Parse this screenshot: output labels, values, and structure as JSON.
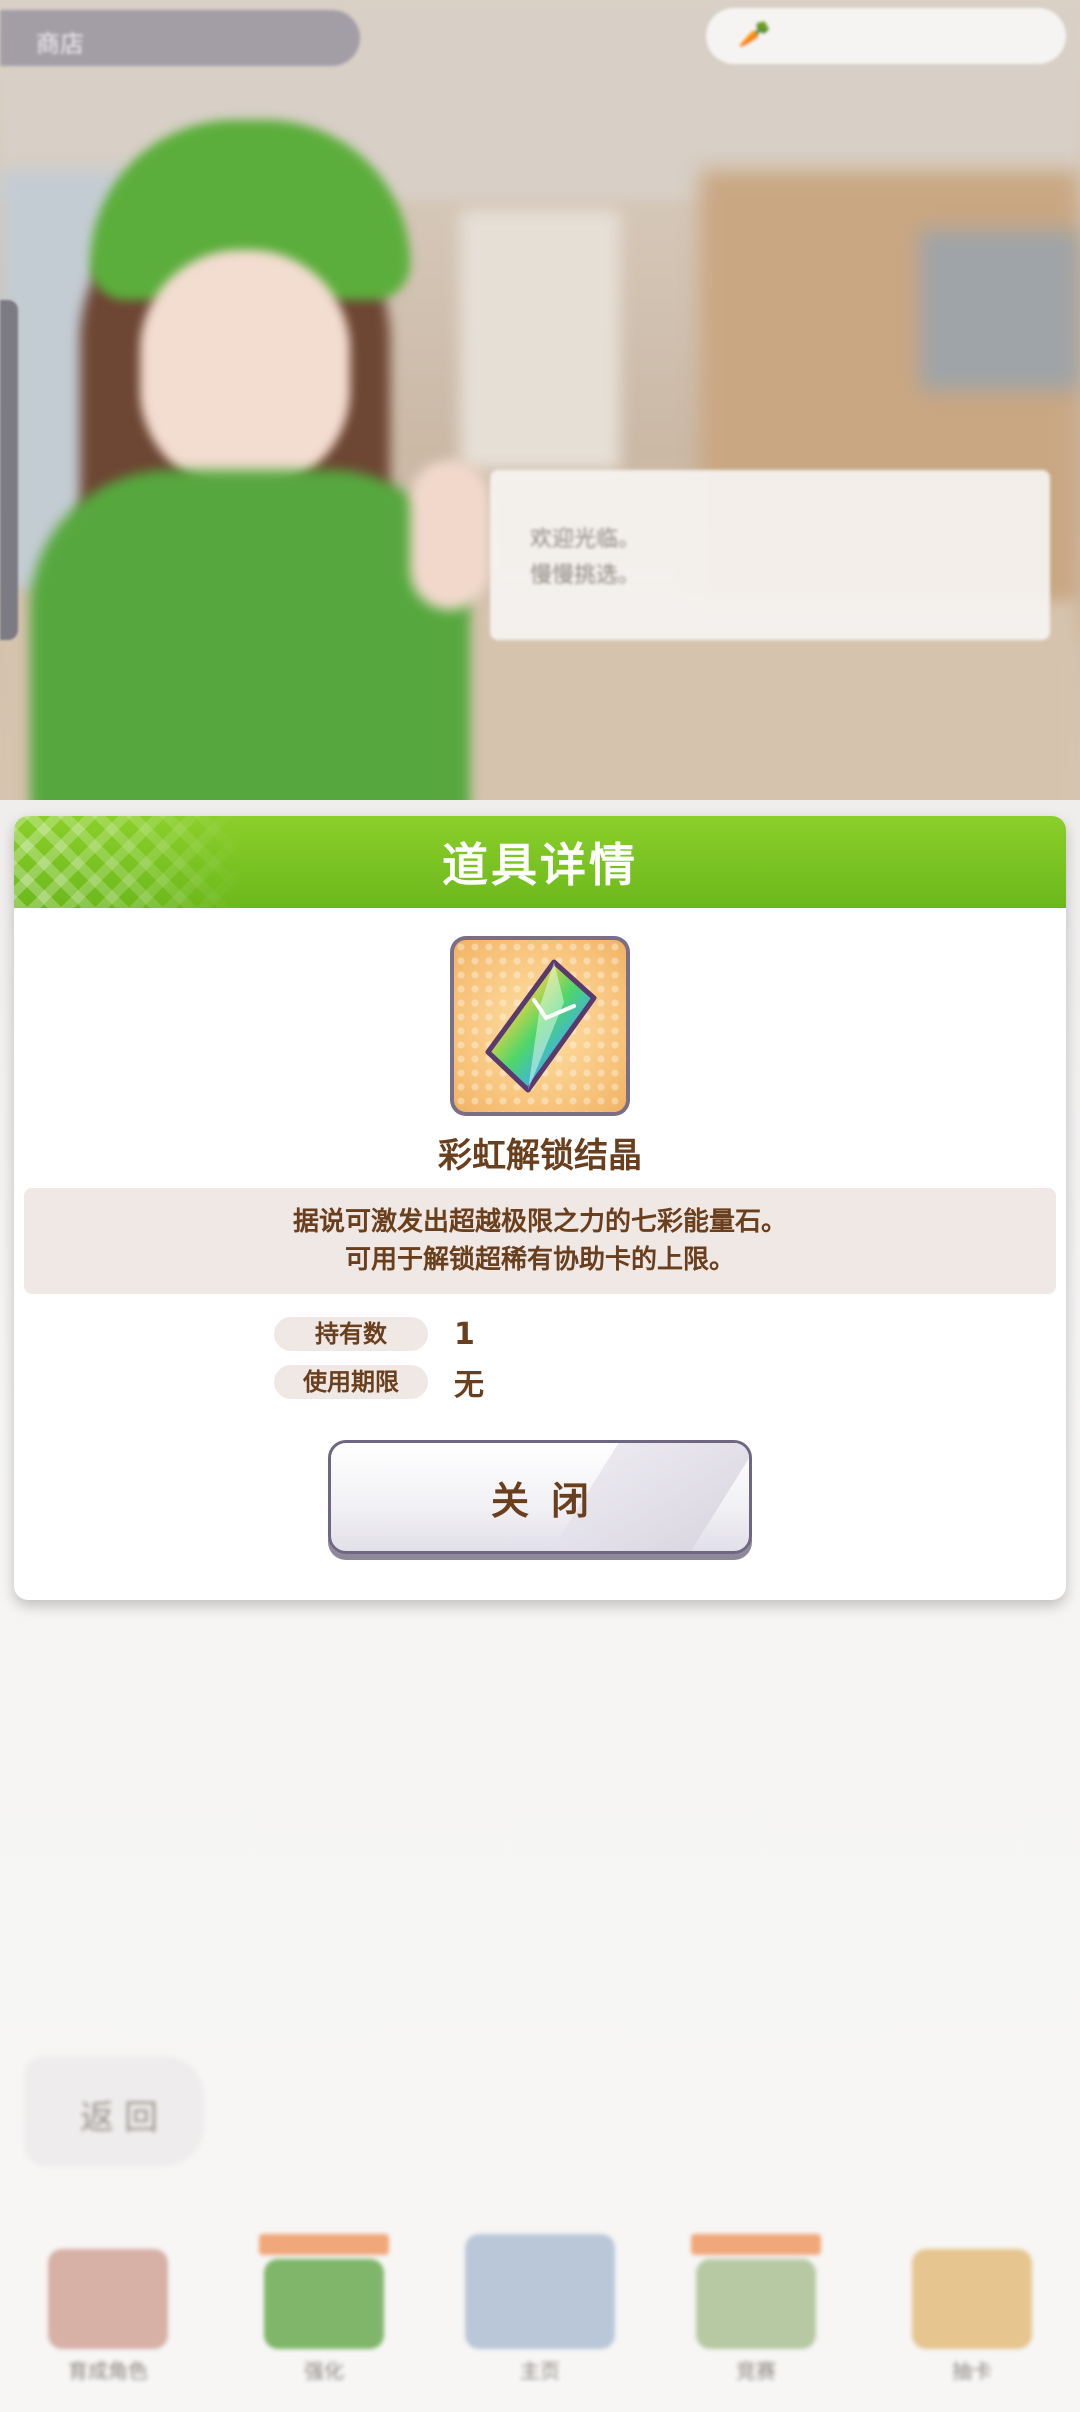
{
  "background": {
    "location_label": "商店",
    "dialogue_lines": [
      "欢迎光临。",
      "慢慢挑选。"
    ],
    "back_label": "返回",
    "nav_items": [
      {
        "label": "育成角色",
        "has_tag": false,
        "color": "#d7b0a6"
      },
      {
        "label": "强化",
        "has_tag": true,
        "color": "#7fb66a"
      },
      {
        "label": "主页",
        "has_tag": false,
        "color": "#b9c7d8"
      },
      {
        "label": "竞赛",
        "has_tag": true,
        "color": "#b7c9a3"
      },
      {
        "label": "抽卡",
        "has_tag": false,
        "color": "#e6c58f"
      }
    ]
  },
  "dialog": {
    "title": "道具详情",
    "item_icon": "rainbow-crystal-icon",
    "item_name": "彩虹解锁结晶",
    "description": [
      "据说可激发出超越极限之力的七彩能量石。",
      "可用于解锁超稀有协助卡的上限。"
    ],
    "held_label": "持有数",
    "held_value": "1",
    "expiry_label": "使用期限",
    "expiry_value": "无",
    "close_label": "关闭"
  },
  "colors": {
    "header_green": "#7cc524",
    "text_brown": "#6a3f1e",
    "label_bg": "#efe8e5"
  }
}
